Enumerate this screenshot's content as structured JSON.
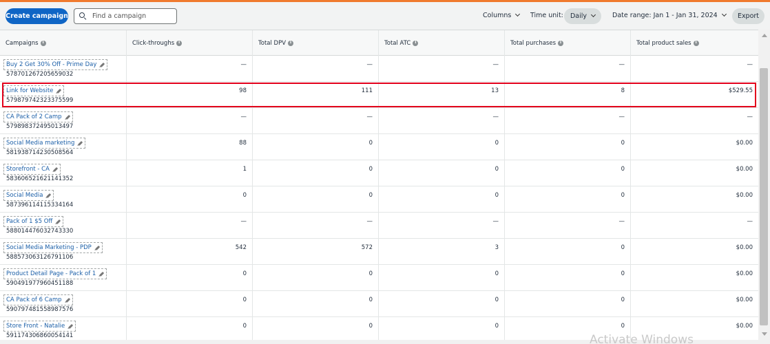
{
  "toolbar": {
    "create_label": "Create campaign",
    "search_placeholder": "Find a campaign",
    "columns_label": "Columns",
    "time_unit_label": "Time unit:",
    "time_unit_value": "Daily",
    "date_range_label": "Date range: Jan 1 - Jan 31, 2024",
    "export_label": "Export"
  },
  "colors": {
    "accent": "#0f65c5",
    "highlight": "#e3001b",
    "top_line": "#f07a2e"
  },
  "table": {
    "columns": [
      "Campaigns",
      "Click-throughs",
      "Total DPV",
      "Total ATC",
      "Total purchases",
      "Total product sales"
    ],
    "rows": [
      {
        "name": "Buy 2 Get 30% Off - Prime Day",
        "id": "578701267205659032",
        "clicks": "—",
        "dpv": "—",
        "atc": "—",
        "purchases": "—",
        "sales": "—"
      },
      {
        "name": "Link for Website",
        "id": "579879742323375599",
        "clicks": "98",
        "dpv": "111",
        "atc": "13",
        "purchases": "8",
        "sales": "$529.55"
      },
      {
        "name": "CA Pack of 2 Camp",
        "id": "579898372495013497",
        "clicks": "—",
        "dpv": "—",
        "atc": "—",
        "purchases": "—",
        "sales": "—"
      },
      {
        "name": "Social Media marketing",
        "id": "581938714230508564",
        "clicks": "88",
        "dpv": "0",
        "atc": "0",
        "purchases": "0",
        "sales": "$0.00"
      },
      {
        "name": "Storefront - CA",
        "id": "583606521621141352",
        "clicks": "1",
        "dpv": "0",
        "atc": "0",
        "purchases": "0",
        "sales": "$0.00"
      },
      {
        "name": "Social Media",
        "id": "587396114115334164",
        "clicks": "0",
        "dpv": "0",
        "atc": "0",
        "purchases": "0",
        "sales": "$0.00"
      },
      {
        "name": "Pack of 1 $5 Off",
        "id": "588014476032743330",
        "clicks": "—",
        "dpv": "—",
        "atc": "—",
        "purchases": "—",
        "sales": "—"
      },
      {
        "name": "Social Media Marketing - PDP",
        "id": "588573063126791106",
        "clicks": "542",
        "dpv": "572",
        "atc": "3",
        "purchases": "0",
        "sales": "$0.00"
      },
      {
        "name": "Product Detail Page - Pack of 1",
        "id": "590491977960451188",
        "clicks": "0",
        "dpv": "0",
        "atc": "0",
        "purchases": "0",
        "sales": "$0.00"
      },
      {
        "name": "CA Pack of 6 Camp",
        "id": "590797481558987576",
        "clicks": "0",
        "dpv": "0",
        "atc": "0",
        "purchases": "0",
        "sales": "$0.00"
      },
      {
        "name": "Store Front - Natalie",
        "id": "591174306860054141",
        "clicks": "0",
        "dpv": "0",
        "atc": "0",
        "purchases": "0",
        "sales": "$0.00"
      }
    ]
  },
  "watermark": "Activate Windows"
}
